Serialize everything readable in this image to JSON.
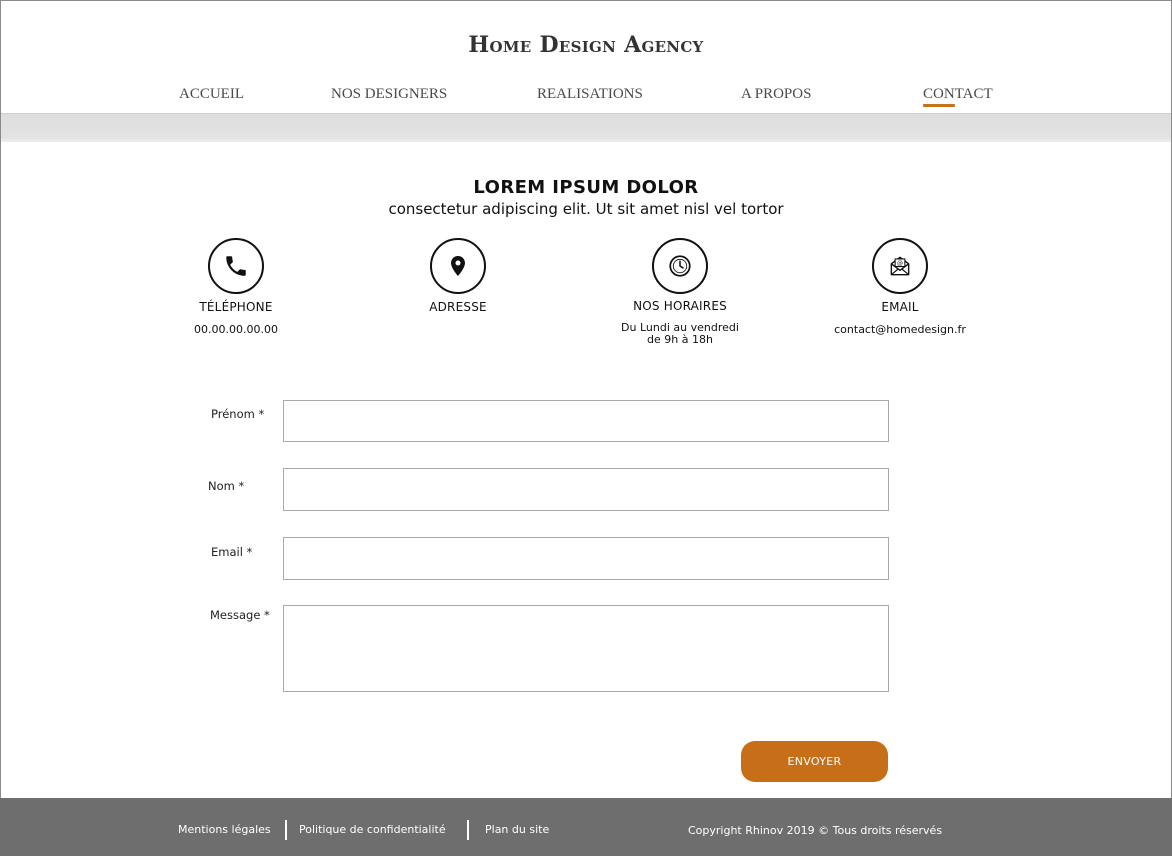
{
  "brand": {
    "name": "Home Design Agency"
  },
  "nav": {
    "items": [
      {
        "label": "ACCUEIL"
      },
      {
        "label": "NOS DESIGNERS"
      },
      {
        "label": "REALISATIONS"
      },
      {
        "label": "A PROPOS"
      },
      {
        "label": "CONTACT",
        "active": true
      }
    ]
  },
  "hero": {
    "title": "LOREM IPSUM DOLOR",
    "subtitle": "consectetur adipiscing elit. Ut sit amet nisl vel tortor"
  },
  "info_blocks": [
    {
      "icon": "phone-icon",
      "title": "TÉLÉPHONE",
      "value": "00.00.00.00.00"
    },
    {
      "icon": "location-pin-icon",
      "title": "ADRESSE",
      "value": ""
    },
    {
      "icon": "clock-icon",
      "title": "NOS HORAIRES",
      "value": "Du Lundi au vendredi\nde 9h à 18h"
    },
    {
      "icon": "email-envelope-icon",
      "title": "EMAIL",
      "value": "contact@homedesign.fr"
    }
  ],
  "form": {
    "fields": [
      {
        "label": "Prénom *",
        "value": ""
      },
      {
        "label": "Nom *",
        "value": ""
      },
      {
        "label": "Email *",
        "value": ""
      },
      {
        "label": "Message *",
        "value": ""
      }
    ],
    "submit_label": "ENVOYER"
  },
  "footer": {
    "links": [
      {
        "label": "Mentions légales"
      },
      {
        "label": "Politique de confidentialité"
      },
      {
        "label": "Plan du site"
      }
    ],
    "copyright": "Copyright Rhinov 2019 © Tous droits réservés"
  },
  "colors": {
    "accent": "#c76f18",
    "footer_bg": "#6e6e6e",
    "band_bg": "#e0e0e0"
  }
}
